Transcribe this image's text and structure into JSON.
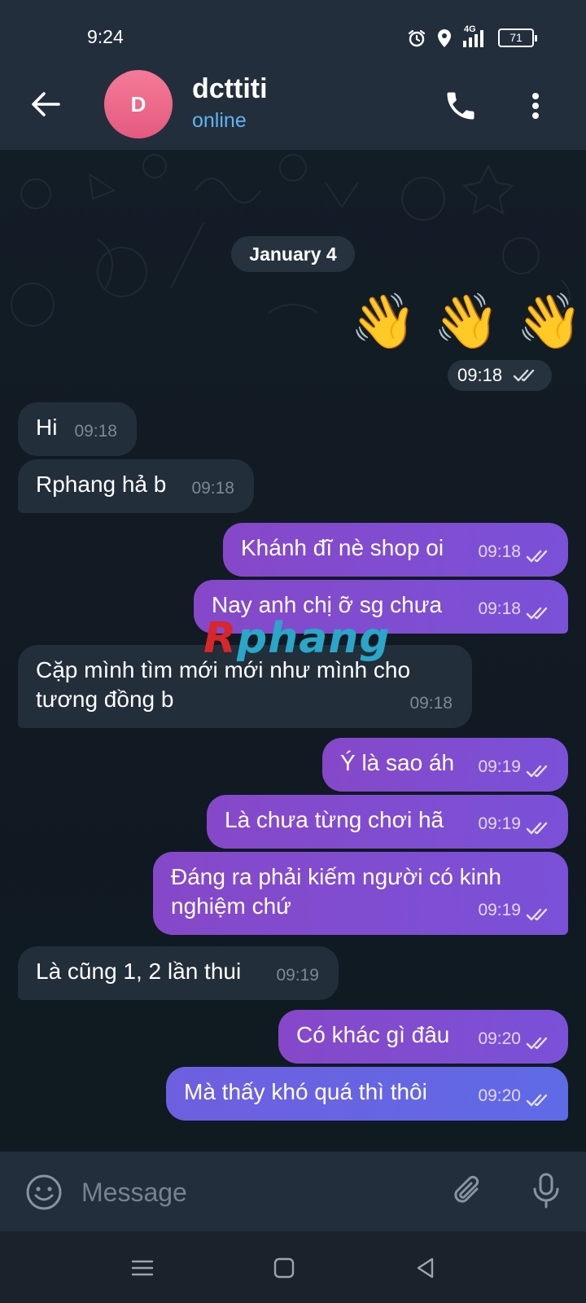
{
  "status": {
    "time": "9:24",
    "network": "4G",
    "battery": "71"
  },
  "header": {
    "avatar_letter": "D",
    "name": "dcttiti",
    "status": "online"
  },
  "chat": {
    "date": "January 4",
    "wave_emojis": [
      "👋",
      "👋",
      "👋"
    ],
    "wave_time": "09:18",
    "messages": [
      {
        "side": "in",
        "text": "Hi",
        "time": "09:18"
      },
      {
        "side": "in",
        "text": "Rphang hả b",
        "time": "09:18"
      },
      {
        "side": "out",
        "text": "Khánh đĩ nè shop oi",
        "time": "09:18"
      },
      {
        "side": "out",
        "text": "Nay anh chị ỡ sg chưa",
        "time": "09:18"
      },
      {
        "side": "in",
        "text": "Cặp mình tìm mới mới như mình cho tương đồng b",
        "time": "09:18"
      },
      {
        "side": "out",
        "text": "Ý là sao áh",
        "time": "09:19"
      },
      {
        "side": "out",
        "text": "Là chưa từng chơi hã",
        "time": "09:19"
      },
      {
        "side": "out",
        "text": "Đáng ra phải kiếm người có kinh nghiệm chứ",
        "time": "09:19"
      },
      {
        "side": "in",
        "text": "Là cũng 1, 2 lần thui",
        "time": "09:19"
      },
      {
        "side": "out",
        "text": "Có khác gì đâu",
        "time": "09:20"
      },
      {
        "side": "out",
        "text": "Mà thấy khó quá thì thôi",
        "time": "09:20"
      }
    ],
    "watermark": {
      "first_letter": "R",
      "rest": "phang"
    }
  },
  "input": {
    "placeholder": "Message"
  },
  "icons": {
    "back": "arrow-left-icon",
    "call": "phone-icon",
    "menu": "more-vertical-icon",
    "emoji": "smiley-icon",
    "attach": "paperclip-icon",
    "mic": "microphone-icon",
    "read": "double-check-icon"
  },
  "colors": {
    "header_bg": "#232e3c",
    "chat_bg": "#111922",
    "incoming_bubble": "#222e3a",
    "outgoing_bubble": "#8648c9",
    "online": "#5fb4f0",
    "avatar": "#ef6f90"
  }
}
